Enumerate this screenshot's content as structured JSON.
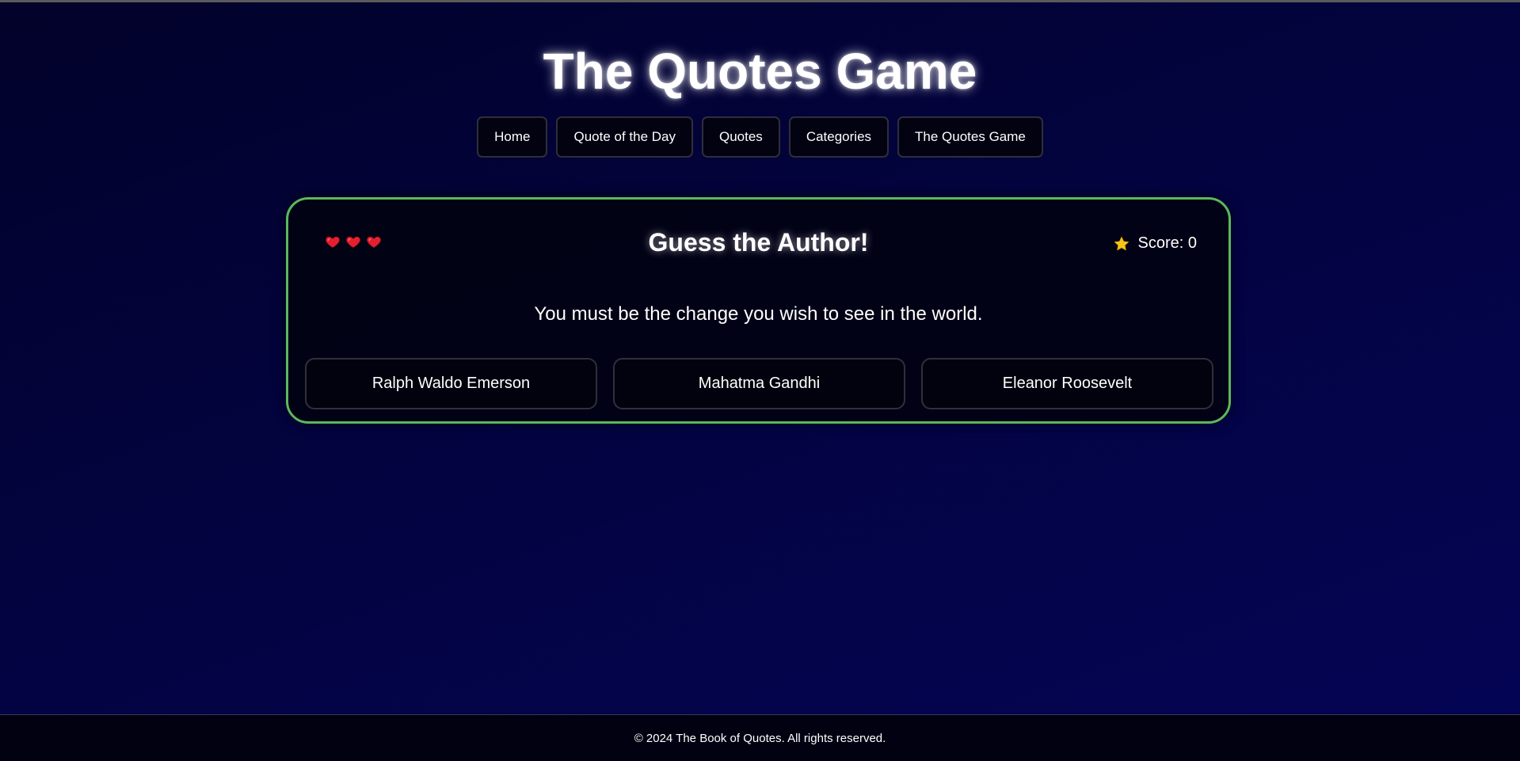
{
  "site": {
    "title": "The Quotes Game"
  },
  "nav": {
    "items": [
      {
        "label": "Home"
      },
      {
        "label": "Quote of the Day"
      },
      {
        "label": "Quotes"
      },
      {
        "label": "Categories"
      },
      {
        "label": "The Quotes Game"
      }
    ]
  },
  "game": {
    "title": "Guess the Author!",
    "lives": {
      "remaining": 3,
      "icon": "heart-icon",
      "color": "#e5202e"
    },
    "score": {
      "icon": "star-icon",
      "label": "Score: 0",
      "value": 0,
      "color": "#f5c518"
    },
    "quote": "You must be the change you wish to see in the world.",
    "options": [
      {
        "label": "Ralph Waldo Emerson"
      },
      {
        "label": "Mahatma Gandhi"
      },
      {
        "label": "Eleanor Roosevelt"
      }
    ],
    "accent_color": "#5cb85c"
  },
  "footer": {
    "text": "© 2024 The Book of Quotes. All rights reserved."
  }
}
